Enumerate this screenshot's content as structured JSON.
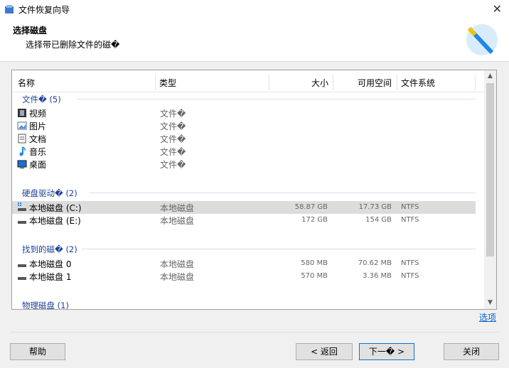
{
  "window": {
    "title": "文件恢复向导",
    "close_glyph": "✕"
  },
  "header": {
    "title": "选择磁盘",
    "subtitle": "选择带已删除文件的磁�"
  },
  "columns": {
    "name": "名称",
    "type": "类型",
    "size": "大小",
    "free": "可用空间",
    "fs": "文件系统"
  },
  "groups": {
    "files": {
      "label": "文件� (5)",
      "items": [
        {
          "name": "视频",
          "type": "文件�",
          "icon": "video-icon"
        },
        {
          "name": "图片",
          "type": "文件�",
          "icon": "image-icon"
        },
        {
          "name": "文档",
          "type": "文件�",
          "icon": "document-icon"
        },
        {
          "name": "音乐",
          "type": "文件�",
          "icon": "music-icon"
        },
        {
          "name": "桌面",
          "type": "文件�",
          "icon": "desktop-icon"
        }
      ]
    },
    "drives": {
      "label": "硬盘驱动� (2)",
      "items": [
        {
          "name": "本地磁盘 (C:)",
          "type": "本地磁盘",
          "size": "58.87 GB",
          "free": "17.73 GB",
          "fs": "NTFS",
          "selected": true
        },
        {
          "name": "本地磁盘 (E:)",
          "type": "本地磁盘",
          "size": "172 GB",
          "free": "154 GB",
          "fs": "NTFS"
        }
      ]
    },
    "found": {
      "label": "找到的磁� (2)",
      "items": [
        {
          "name": "本地磁盘 0",
          "type": "本地磁盘",
          "size": "580 MB",
          "free": "70.62 MB",
          "fs": "NTFS"
        },
        {
          "name": "本地磁盘 1",
          "type": "本地磁盘",
          "size": "570 MB",
          "free": "3.36 MB",
          "fs": "NTFS"
        }
      ]
    },
    "physical": {
      "label": "物理磁盘 (1)"
    }
  },
  "links": {
    "options": "选项"
  },
  "buttons": {
    "help": "帮助",
    "back": "< 返回",
    "next": "下一� >",
    "close": "关闭"
  },
  "scroll": {
    "up": "▲",
    "down": "▼"
  }
}
